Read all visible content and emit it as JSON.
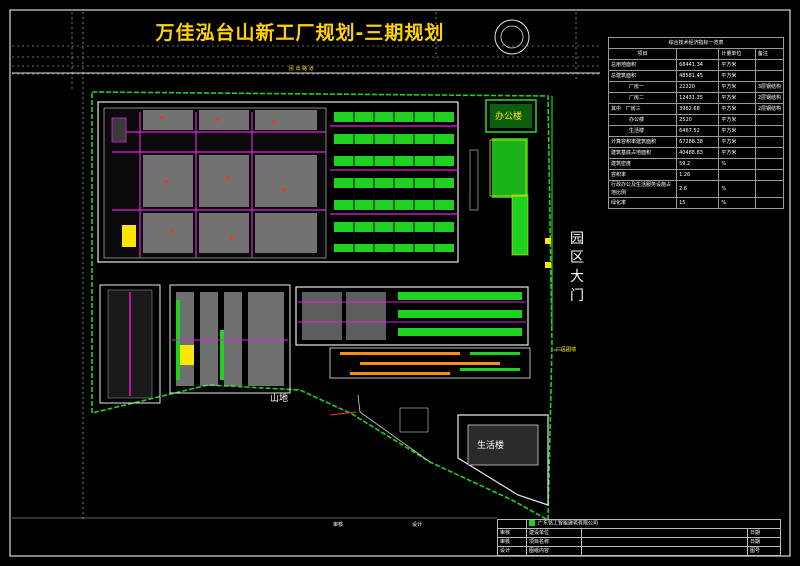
{
  "title": "万佳泓台山新工厂规划-三期规划",
  "labels": {
    "office": "办公楼",
    "dormitory": "生活楼",
    "mountain": "山地",
    "gate": "园区大门",
    "road": "民 出 路 道",
    "factory_gate": "厂区围墙"
  },
  "spec_table": {
    "caption": "综合技术经济指标一览表",
    "header": [
      "项目",
      "",
      "计量单位",
      "备注"
    ],
    "rows": [
      [
        "总用地面积",
        "68441.34",
        "平方米",
        ""
      ],
      [
        "总建筑面积",
        "48581.45",
        "平方米",
        ""
      ],
      [
        "厂房一",
        "22220",
        "平方米",
        "3层钢结构"
      ],
      [
        "厂房二",
        "12431.35",
        "平方米",
        "2层钢结构"
      ],
      [
        "厂房三",
        "3962.68",
        "平方米",
        "2层钢结构"
      ],
      [
        "办公楼",
        "2520",
        "平方米",
        ""
      ],
      [
        "生活楼",
        "6467.52",
        "平方米",
        ""
      ],
      [
        "计算容积率建筑面积",
        "67288.38",
        "平方米",
        ""
      ],
      [
        "建筑基底占地面积",
        "40488.83",
        "平方米",
        ""
      ],
      [
        "建筑密度",
        "59.2",
        "%",
        ""
      ],
      [
        "容积率",
        "1.26",
        "",
        ""
      ],
      [
        "行政办公及生活服务设施占地比例",
        "2.6",
        "%",
        ""
      ],
      [
        "绿化率",
        "15",
        "%",
        ""
      ]
    ],
    "group_label": "其中"
  },
  "title_block": {
    "left_a": "审核",
    "left_b": "设计",
    "company": "广东铭工智能建筑有限公司",
    "rows": [
      [
        "审核",
        "建设单位",
        "",
        "日期"
      ],
      [
        "审核",
        "项目名称",
        "",
        "日期"
      ],
      [
        "设计",
        "图纸内容",
        "",
        "图号"
      ]
    ]
  }
}
